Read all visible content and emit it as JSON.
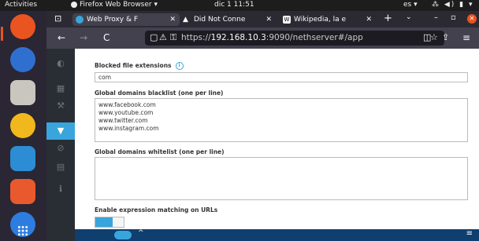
{
  "topbar": {
    "activities": "Activities",
    "app_name": "Firefox Web Browser ▾",
    "clock": "dic 1  11:51",
    "language": "es ▾",
    "status_icons": "⁂ ◀) ▮ ▾"
  },
  "dock": {
    "items": [
      {
        "name": "ubuntu-logo-icon",
        "color": "#e95420"
      },
      {
        "name": "firefox-icon",
        "color": "#2f6fd0"
      },
      {
        "name": "files-icon",
        "color": "#c9c5bf"
      },
      {
        "name": "rhythmbox-icon",
        "color": "#f0b81c"
      },
      {
        "name": "writer-icon",
        "color": "#2c8dd4"
      },
      {
        "name": "software-icon",
        "color": "#e9592e"
      },
      {
        "name": "help-icon",
        "color": "#2d7de0"
      }
    ]
  },
  "browser": {
    "tablist_icon": "⊡",
    "tabs": [
      {
        "label": "Web Proxy & F",
        "close": "✕",
        "favicon_color": "#39a5dc"
      },
      {
        "label": "Did Not Conne",
        "close": "✕",
        "favicon_color": "#fbfbfe",
        "favicon_glyph": "▲"
      },
      {
        "label": "Wikipedia, la e",
        "close": "✕",
        "favicon_color": "#fbfbfe",
        "favicon_glyph": "W"
      }
    ],
    "new_tab": "+",
    "tab_chevron": "⌄",
    "minimize": "–",
    "maximize": "▫",
    "close": "✕",
    "nav": {
      "back": "←",
      "forward": "→",
      "reload": "C",
      "shield": "🛡",
      "lock": "🔒",
      "perm": "⚿",
      "url_prefix": "https://",
      "url_host": "192.168.10.3",
      "url_rest": ":9090/nethserver#/app",
      "star": "☆",
      "pocket": "◫",
      "share": "⇪",
      "menu": "≡"
    }
  },
  "page": {
    "sidebar_icons": [
      "◐",
      "▦",
      "⚒",
      "▼",
      "⊘",
      "▤",
      "ℹ"
    ],
    "active_index": 3,
    "blocked_ext_label": "Blocked file extensions",
    "blocked_ext_value": "com",
    "blacklist_label": "Global domains blacklist (one per line)",
    "blacklist_lines": [
      "www.facebook.com",
      "www.youtube.com",
      "www.twitter.com",
      "www.instagram.com"
    ],
    "whitelist_label": "Global domains whitelist (one per line)",
    "whitelist_lines": [],
    "expression_label": "Enable expression matching on URLs",
    "expression_enabled": true,
    "bottom_chevron": "^",
    "bottom_menu": "≡"
  }
}
